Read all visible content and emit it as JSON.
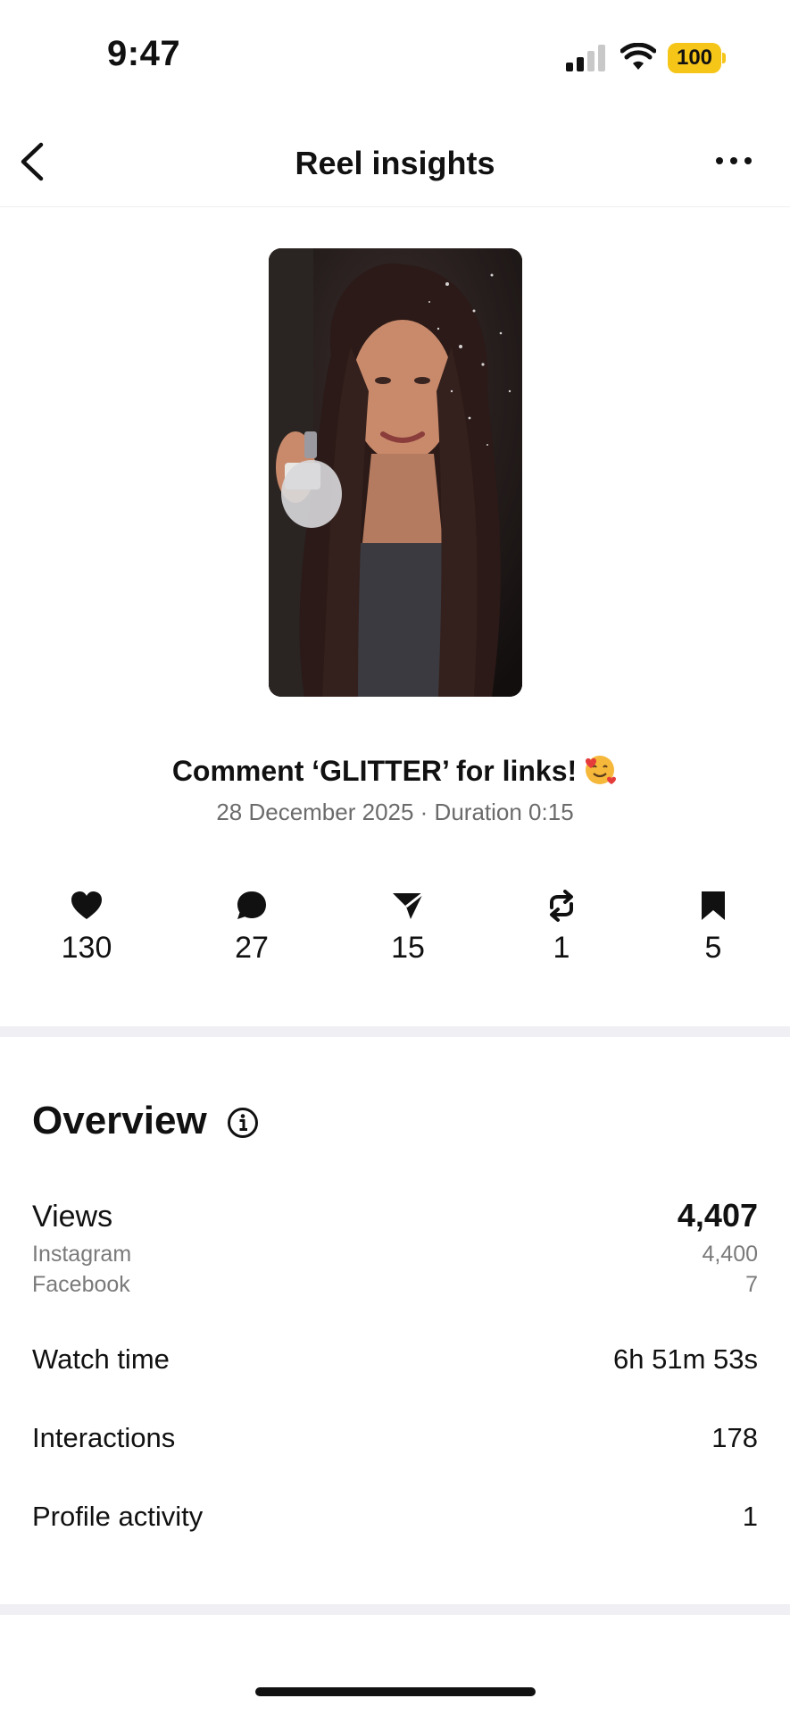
{
  "status_bar": {
    "time": "9:47",
    "battery": "100"
  },
  "header": {
    "title": "Reel insights"
  },
  "reel": {
    "caption": "Comment ‘GLITTER’ for links!",
    "caption_emoji": "smiling-face-with-hearts",
    "meta": "28 December 2025 · Duration 0:15"
  },
  "stats": [
    {
      "icon": "heart-icon",
      "value": "130"
    },
    {
      "icon": "comment-icon",
      "value": "27"
    },
    {
      "icon": "send-icon",
      "value": "15"
    },
    {
      "icon": "repost-icon",
      "value": "1"
    },
    {
      "icon": "bookmark-icon",
      "value": "5"
    }
  ],
  "overview": {
    "title": "Overview",
    "views": {
      "label": "Views",
      "value": "4,407",
      "breakdown": [
        {
          "label": "Instagram",
          "value": "4,400"
        },
        {
          "label": "Facebook",
          "value": "7"
        }
      ]
    },
    "rows": [
      {
        "label": "Watch time",
        "value": "6h 51m 53s"
      },
      {
        "label": "Interactions",
        "value": "178"
      },
      {
        "label": "Profile activity",
        "value": "1"
      }
    ]
  },
  "colors": {
    "battery": "#f5c518",
    "divider": "#efeff4",
    "secondary_text": "#7a7a7a"
  }
}
